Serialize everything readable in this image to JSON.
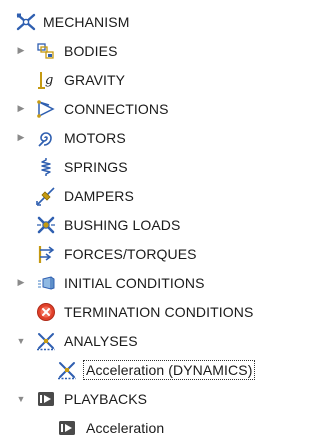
{
  "tree": {
    "root": {
      "label": "MECHANISM",
      "icon": "mechanism-icon"
    },
    "items": [
      {
        "label": "BODIES",
        "icon": "bodies-icon",
        "expandable": true,
        "expanded": false
      },
      {
        "label": "GRAVITY",
        "icon": "gravity-icon",
        "expandable": false
      },
      {
        "label": "CONNECTIONS",
        "icon": "connections-icon",
        "expandable": true,
        "expanded": false
      },
      {
        "label": "MOTORS",
        "icon": "motors-icon",
        "expandable": true,
        "expanded": false
      },
      {
        "label": "SPRINGS",
        "icon": "springs-icon",
        "expandable": false
      },
      {
        "label": "DAMPERS",
        "icon": "dampers-icon",
        "expandable": false
      },
      {
        "label": "BUSHING LOADS",
        "icon": "bushing-loads-icon",
        "expandable": false
      },
      {
        "label": "FORCES/TORQUES",
        "icon": "forces-torques-icon",
        "expandable": false
      },
      {
        "label": "INITIAL CONDITIONS",
        "icon": "initial-conditions-icon",
        "expandable": true,
        "expanded": false
      },
      {
        "label": "TERMINATION CONDITIONS",
        "icon": "termination-conditions-icon",
        "expandable": false
      },
      {
        "label": "ANALYSES",
        "icon": "analyses-icon",
        "expandable": true,
        "expanded": true,
        "children": [
          {
            "label": "Acceleration (DYNAMICS)",
            "icon": "analysis-icon",
            "selected": true
          }
        ]
      },
      {
        "label": "PLAYBACKS",
        "icon": "playbacks-icon",
        "expandable": true,
        "expanded": true,
        "children": [
          {
            "label": "Acceleration",
            "icon": "playback-icon"
          }
        ]
      }
    ]
  },
  "glyphs": {
    "collapsed": "▶",
    "expanded": "▼"
  },
  "colors": {
    "text": "#1a1a1a",
    "expander": "#8a8a8a",
    "mechanism_blue": "#2f5fb0",
    "termination_red": "#e0402a",
    "playback_gray": "#4a4a4a"
  }
}
